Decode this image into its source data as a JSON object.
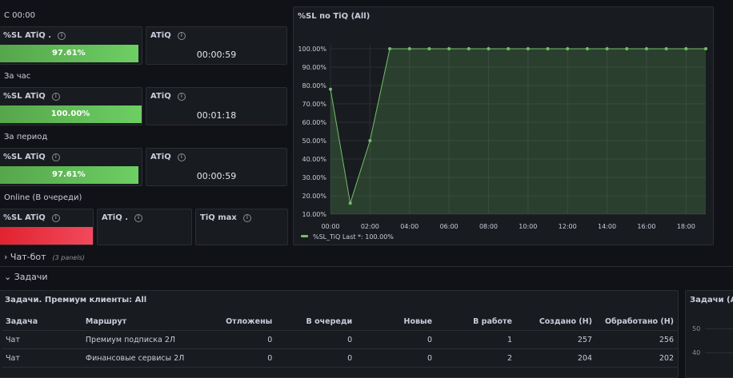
{
  "sections": {
    "s1": "С 00:00",
    "s2": "За час",
    "s3": "За период",
    "s4": "Online (В очереди)"
  },
  "stats": {
    "r1a": {
      "title": "%SL ATiQ .",
      "value": "97.61%",
      "fill": 0.9761
    },
    "r1b": {
      "title": "ATiQ",
      "value": "00:00:59"
    },
    "r2a": {
      "title": "%SL ATiQ",
      "value": "100.00%",
      "fill": 1.0
    },
    "r2b": {
      "title": "ATiQ",
      "value": "00:01:18"
    },
    "r3a": {
      "title": "%SL ATiQ",
      "value": "97.61%",
      "fill": 0.9761
    },
    "r3b": {
      "title": "ATiQ",
      "value": "00:00:59"
    },
    "r4a": {
      "title": "%SL ATiQ"
    },
    "r4b": {
      "title": "ATiQ ."
    },
    "r4c": {
      "title": "TiQ max"
    }
  },
  "info_icon": "info-circle-icon",
  "chart_data": {
    "type": "area",
    "title": "%SL по TiQ (All)",
    "x": [
      "00:00",
      "01:00",
      "02:00",
      "03:00",
      "04:00",
      "05:00",
      "06:00",
      "07:00",
      "08:00",
      "09:00",
      "10:00",
      "11:00",
      "12:00",
      "13:00",
      "14:00",
      "15:00",
      "16:00",
      "17:00",
      "18:00",
      "19:00"
    ],
    "series": [
      {
        "name": "%SL_TiQ",
        "values": [
          78,
          16,
          50,
          100,
          100,
          100,
          100,
          100,
          100,
          100,
          100,
          100,
          100,
          100,
          100,
          100,
          100,
          100,
          100,
          100
        ]
      }
    ],
    "x_tick_labels": [
      "00:00",
      "02:00",
      "04:00",
      "06:00",
      "08:00",
      "10:00",
      "12:00",
      "14:00",
      "16:00",
      "18:00"
    ],
    "y_tick_labels": [
      "10.00%",
      "20.00%",
      "30.00%",
      "40.00%",
      "50.00%",
      "60.00%",
      "70.00%",
      "80.00%",
      "90.00%",
      "100.00%"
    ],
    "ylim": [
      10,
      100
    ],
    "legend_text": "%SL_TiQ   Last *: 100.00%",
    "legend_position": "bottom-left",
    "grid": true,
    "color": "#73bf69"
  },
  "rows": {
    "chatbot": {
      "label": "Чат-бот",
      "sub": "(3 panels)"
    },
    "tasks": {
      "label": "Задачи"
    }
  },
  "table": {
    "title": "Задачи. Премиум клиенты: All",
    "headers": [
      "Задача",
      "Маршрут",
      "Отложены",
      "В очереди",
      "Новые",
      "В работе",
      "Создано (Н)",
      "Обработано (Н)"
    ],
    "rows": [
      [
        "Чат",
        "Премиум подписка 2Л",
        "0",
        "0",
        "0",
        "1",
        "257",
        "256"
      ],
      [
        "Чат",
        "Финансовые сервисы 2Л",
        "0",
        "0",
        "0",
        "2",
        "204",
        "202"
      ]
    ]
  },
  "side_panel": {
    "title": "Задачи (All)",
    "y_ticks": [
      "50",
      "40"
    ]
  },
  "colors": {
    "green": "#73bf69",
    "red": "#f2495c",
    "bg": "#111217",
    "panel": "#181b1f"
  }
}
